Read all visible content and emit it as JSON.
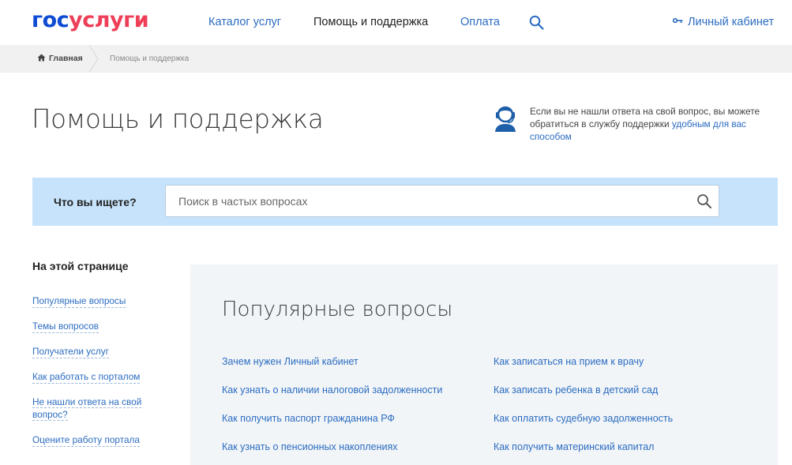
{
  "header": {
    "logo_part1": "гос",
    "logo_part2": "услуги",
    "nav": {
      "catalog": "Каталог услуг",
      "help": "Помощь и поддержка",
      "payment": "Оплата"
    },
    "cabinet": "Личный кабинет"
  },
  "breadcrumb": {
    "home": "Главная",
    "current": "Помощь и поддержка"
  },
  "page": {
    "title": "Помощь и поддержка",
    "support_text": "Если вы не нашли ответа на свой вопрос, вы можете обратиться в службу поддержки ",
    "support_link": "удобным для вас способом"
  },
  "search": {
    "label": "Что вы ищете?",
    "placeholder": "Поиск в частых вопросах"
  },
  "sidebar": {
    "title": "На этой странице",
    "links": [
      "Популярные вопросы",
      "Темы вопросов",
      "Получатели услуг",
      "Как работать с порталом",
      "Не нашли ответа на свой вопрос?",
      "Оцените работу портала"
    ]
  },
  "popular": {
    "title": "Популярные вопросы",
    "left": [
      "Зачем нужен Личный кабинет",
      "Как узнать о наличии налоговой задолженности",
      "Как получить паспорт гражданина РФ",
      "Как узнать о пенсионных накоплениях"
    ],
    "right": [
      "Как записаться на прием к врачу",
      "Как записать ребенка в детский сад",
      "Как оплатить судебную задолженность",
      "Как получить материнский капитал"
    ]
  },
  "icons": {
    "search": "search-icon",
    "key": "key-icon",
    "home": "home-icon",
    "support": "support-operator-icon"
  },
  "colors": {
    "brand_blue": "#0d4cd3",
    "brand_red": "#ee3f58",
    "link": "#2b6cc0",
    "search_band": "#c7e3fb",
    "panel_bg": "#f2f5f8"
  }
}
